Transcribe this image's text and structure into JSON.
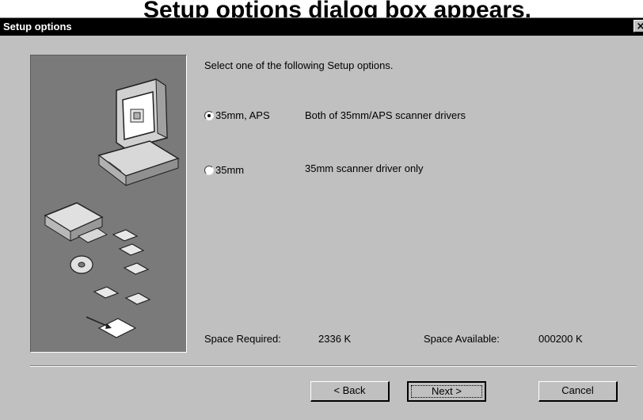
{
  "page_heading": "Setup options dialog box appears.",
  "window": {
    "title": "Setup options",
    "close_glyph": "×"
  },
  "prompt": "Select one of the following Setup options.",
  "options": [
    {
      "label": "35mm, APS",
      "description": "Both of 35mm/APS scanner drivers",
      "selected": true
    },
    {
      "label": "35mm",
      "description": "35mm scanner driver only",
      "selected": false
    }
  ],
  "space": {
    "required_label": "Space Required:",
    "required_value": "2336 K",
    "available_label": "Space Available:",
    "available_value": "000200 K"
  },
  "buttons": {
    "back": "< Back",
    "next": "Next >",
    "cancel": "Cancel"
  },
  "icons": [
    "computer-icon",
    "cd-disc-icon",
    "floppy-disk-icon",
    "document-icon"
  ]
}
